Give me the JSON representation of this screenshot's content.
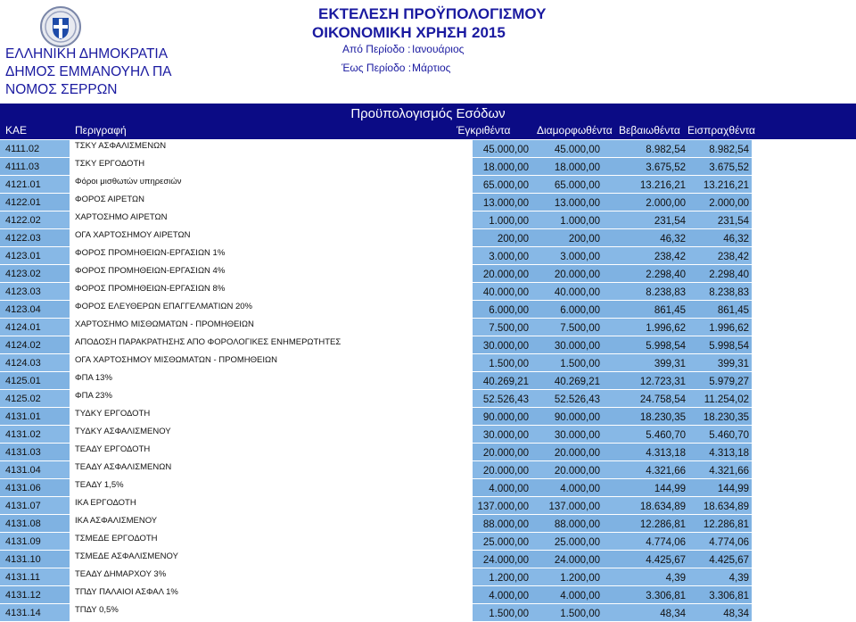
{
  "header": {
    "org_lines": [
      "ΕΛΛΗΝΙΚΗ ΔΗΜΟΚΡΑΤΙΑ",
      "ΔΗΜΟΣ ΕΜΜΑΝΟΥΗΛ ΠΑ",
      "ΝΟΜΟΣ ΣΕΡΡΩΝ"
    ],
    "report_title": "ΕΚΤΕΛΕΣΗ ΠΡΟΫΠΟΛΟΓΙΣΜΟΥ",
    "fiscal_year_label": "ΟΙΚΟΝΟΜΙΚΗ ΧΡΗΣΗ",
    "fiscal_year_value": "2015",
    "period_from_label": "Από Περίοδο :",
    "period_from_value": "Ιανουάριος",
    "period_to_label": "Έως Περίοδο :",
    "period_to_value": "Μάρτιος"
  },
  "section": {
    "title": "Προϋπολογισμός Εσόδων",
    "columns": [
      "ΚΑΕ",
      "Περιγραφή",
      "Έγκριθέντα",
      "Διαμορφωθέντα",
      "Βεβαιωθέντα",
      "Εισπραχθέντα"
    ]
  },
  "rows": [
    {
      "kae": "4111.02",
      "desc": "ΤΣΚΥ ΑΣΦΑΛΙΣΜΕΝΩΝ",
      "approved": "45.000,00",
      "formed": "45.000,00",
      "certified": "8.982,54",
      "collected": "8.982,54"
    },
    {
      "kae": "4111.03",
      "desc": "ΤΣΚΥ ΕΡΓΟΔΟΤΗ",
      "approved": "18.000,00",
      "formed": "18.000,00",
      "certified": "3.675,52",
      "collected": "3.675,52"
    },
    {
      "kae": "4121.01",
      "desc": "Φόροι μισθωτών υπηρεσιών",
      "approved": "65.000,00",
      "formed": "65.000,00",
      "certified": "13.216,21",
      "collected": "13.216,21"
    },
    {
      "kae": "4122.01",
      "desc": "ΦΟΡΟΣ ΑΙΡΕΤΩΝ",
      "approved": "13.000,00",
      "formed": "13.000,00",
      "certified": "2.000,00",
      "collected": "2.000,00"
    },
    {
      "kae": "4122.02",
      "desc": "ΧΑΡΤΟΣΗΜΟ ΑΙΡΕΤΩΝ",
      "approved": "1.000,00",
      "formed": "1.000,00",
      "certified": "231,54",
      "collected": "231,54"
    },
    {
      "kae": "4122.03",
      "desc": "ΟΓΑ ΧΑΡΤΟΣΗΜΟΥ ΑΙΡΕΤΩΝ",
      "approved": "200,00",
      "formed": "200,00",
      "certified": "46,32",
      "collected": "46,32"
    },
    {
      "kae": "4123.01",
      "desc": "ΦΟΡΟΣ ΠΡΟΜΗΘΕΙΩΝ-ΕΡΓΑΣΙΩΝ 1%",
      "approved": "3.000,00",
      "formed": "3.000,00",
      "certified": "238,42",
      "collected": "238,42"
    },
    {
      "kae": "4123.02",
      "desc": "ΦΟΡΟΣ ΠΡΟΜΗΘΕΙΩΝ-ΕΡΓΑΣΙΩΝ 4%",
      "approved": "20.000,00",
      "formed": "20.000,00",
      "certified": "2.298,40",
      "collected": "2.298,40"
    },
    {
      "kae": "4123.03",
      "desc": "ΦΟΡΟΣ ΠΡΟΜΗΘΕΙΩΝ-ΕΡΓΑΣΙΩΝ 8%",
      "approved": "40.000,00",
      "formed": "40.000,00",
      "certified": "8.238,83",
      "collected": "8.238,83"
    },
    {
      "kae": "4123.04",
      "desc": "ΦΟΡΟΣ ΕΛΕΥΘΕΡΩΝ ΕΠΑΓΓΕΛΜΑΤΙΩΝ 20%",
      "approved": "6.000,00",
      "formed": "6.000,00",
      "certified": "861,45",
      "collected": "861,45"
    },
    {
      "kae": "4124.01",
      "desc": "ΧΑΡΤΟΣΗΜΟ ΜΙΣΘΩΜΑΤΩΝ - ΠΡΟΜΗΘΕΙΩΝ",
      "approved": "7.500,00",
      "formed": "7.500,00",
      "certified": "1.996,62",
      "collected": "1.996,62"
    },
    {
      "kae": "4124.02",
      "desc": "ΑΠΟΔΟΣΗ ΠΑΡΑΚΡΑΤΗΣΗΣ ΑΠΟ ΦΟΡΟΛΟΓΙΚΕΣ ΕΝΗΜΕΡΩΤΗΤΕΣ",
      "approved": "30.000,00",
      "formed": "30.000,00",
      "certified": "5.998,54",
      "collected": "5.998,54"
    },
    {
      "kae": "4124.03",
      "desc": "ΟΓΑ ΧΑΡΤΟΣΗΜΟΥ ΜΙΣΘΩΜΑΤΩΝ - ΠΡΟΜΗΘΕΙΩΝ",
      "approved": "1.500,00",
      "formed": "1.500,00",
      "certified": "399,31",
      "collected": "399,31"
    },
    {
      "kae": "4125.01",
      "desc": "ΦΠΑ 13%",
      "approved": "40.269,21",
      "formed": "40.269,21",
      "certified": "12.723,31",
      "collected": "5.979,27"
    },
    {
      "kae": "4125.02",
      "desc": "ΦΠΑ 23%",
      "approved": "52.526,43",
      "formed": "52.526,43",
      "certified": "24.758,54",
      "collected": "11.254,02"
    },
    {
      "kae": "4131.01",
      "desc": "ΤΥΔΚΥ ΕΡΓΟΔΟΤΗ",
      "approved": "90.000,00",
      "formed": "90.000,00",
      "certified": "18.230,35",
      "collected": "18.230,35"
    },
    {
      "kae": "4131.02",
      "desc": "ΤΥΔΚΥ ΑΣΦΑΛΙΣΜΕΝΟΥ",
      "approved": "30.000,00",
      "formed": "30.000,00",
      "certified": "5.460,70",
      "collected": "5.460,70"
    },
    {
      "kae": "4131.03",
      "desc": "ΤΕΑΔΥ  ΕΡΓΟΔΟΤΗ",
      "approved": "20.000,00",
      "formed": "20.000,00",
      "certified": "4.313,18",
      "collected": "4.313,18"
    },
    {
      "kae": "4131.04",
      "desc": "ΤΕΑΔΥ  ΑΣΦΑΛΙΣΜΕΝΩΝ",
      "approved": "20.000,00",
      "formed": "20.000,00",
      "certified": "4.321,66",
      "collected": "4.321,66"
    },
    {
      "kae": "4131.06",
      "desc": "ΤΕΑΔΥ 1,5%",
      "approved": "4.000,00",
      "formed": "4.000,00",
      "certified": "144,99",
      "collected": "144,99"
    },
    {
      "kae": "4131.07",
      "desc": "ΙΚΑ ΕΡΓΟΔΟΤΗ",
      "approved": "137.000,00",
      "formed": "137.000,00",
      "certified": "18.634,89",
      "collected": "18.634,89"
    },
    {
      "kae": "4131.08",
      "desc": "ΙΚΑ ΑΣΦΑΛΙΣΜΕΝΟΥ",
      "approved": "88.000,00",
      "formed": "88.000,00",
      "certified": "12.286,81",
      "collected": "12.286,81"
    },
    {
      "kae": "4131.09",
      "desc": "ΤΣΜΕΔΕ ΕΡΓΟΔΟΤΗ",
      "approved": "25.000,00",
      "formed": "25.000,00",
      "certified": "4.774,06",
      "collected": "4.774,06"
    },
    {
      "kae": "4131.10",
      "desc": "ΤΣΜΕΔΕ ΑΣΦΑΛΙΣΜΕΝΟΥ",
      "approved": "24.000,00",
      "formed": "24.000,00",
      "certified": "4.425,67",
      "collected": "4.425,67"
    },
    {
      "kae": "4131.11",
      "desc": "ΤΕΑΔΥ ΔΗΜΑΡΧΟΥ 3%",
      "approved": "1.200,00",
      "formed": "1.200,00",
      "certified": "4,39",
      "collected": "4,39"
    },
    {
      "kae": "4131.12",
      "desc": "ΤΠΔΥ ΠΑΛΑΙΟΙ  ΑΣΦΑΛ 1%",
      "approved": "4.000,00",
      "formed": "4.000,00",
      "certified": "3.306,81",
      "collected": "3.306,81"
    },
    {
      "kae": "4131.14",
      "desc": "ΤΠΔΥ 0,5%",
      "approved": "1.500,00",
      "formed": "1.500,00",
      "certified": "48,34",
      "collected": "48,34"
    }
  ]
}
